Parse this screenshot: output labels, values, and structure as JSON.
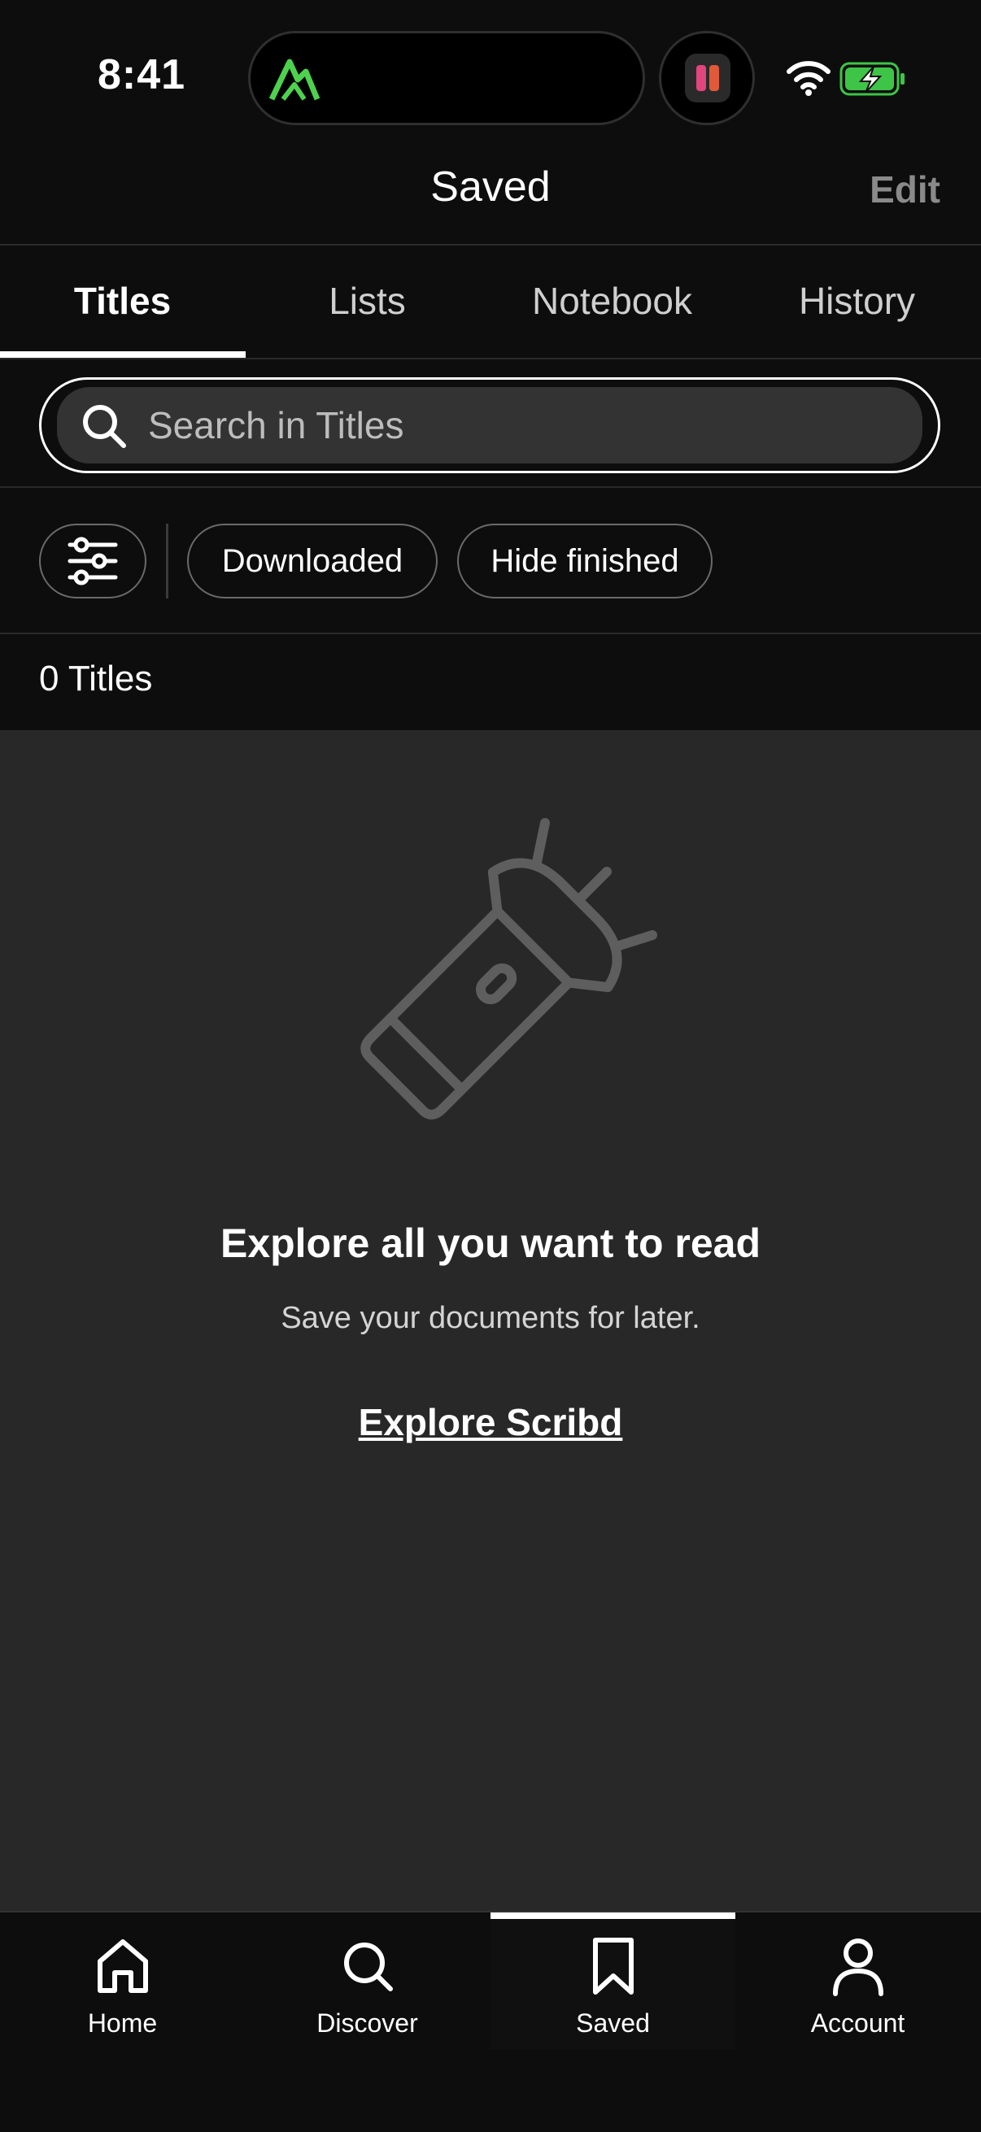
{
  "status_bar": {
    "time": "8:41"
  },
  "header": {
    "title": "Saved",
    "edit_label": "Edit"
  },
  "tabs": [
    {
      "label": "Titles",
      "active": true
    },
    {
      "label": "Lists",
      "active": false
    },
    {
      "label": "Notebook",
      "active": false
    },
    {
      "label": "History",
      "active": false
    }
  ],
  "search": {
    "placeholder": "Search in Titles",
    "value": ""
  },
  "filters": {
    "settings_icon": "sliders-icon",
    "chips": [
      "Downloaded",
      "Hide finished"
    ]
  },
  "count": "0 Titles",
  "empty_state": {
    "icon": "flashlight-icon",
    "title": "Explore all you want to read",
    "subtitle": "Save your documents for later.",
    "link": "Explore Scribd"
  },
  "bottom_nav": [
    {
      "label": "Home",
      "icon": "home-icon",
      "active": false
    },
    {
      "label": "Discover",
      "icon": "search-icon",
      "active": false
    },
    {
      "label": "Saved",
      "icon": "bookmark-icon",
      "active": true
    },
    {
      "label": "Account",
      "icon": "account-icon",
      "active": false
    }
  ],
  "colors": {
    "background": "#0d0d0d",
    "content_background": "#282828",
    "battery_green": "#3ec447",
    "island_icon_green": "#4ed14e"
  }
}
